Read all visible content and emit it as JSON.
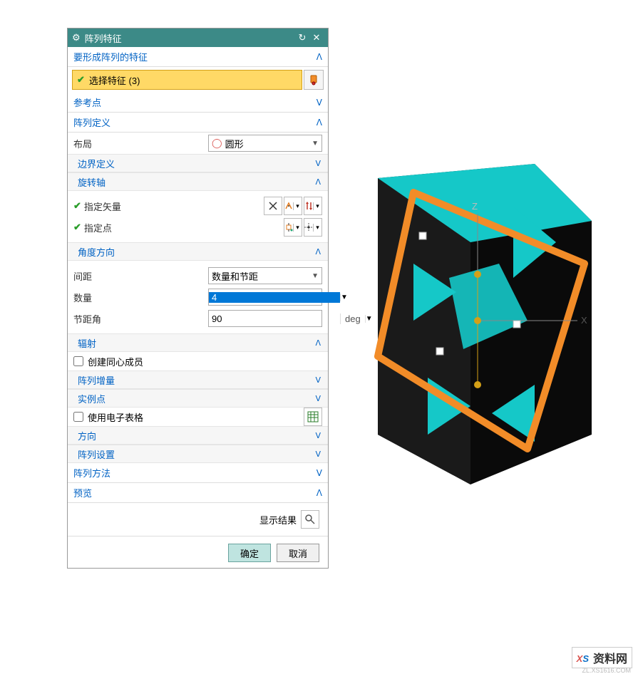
{
  "title": "阵列特征",
  "sections": {
    "features": {
      "title": "要形成阵列的特征",
      "selected_label": "选择特征 (3)"
    },
    "refpoint": {
      "title": "参考点"
    },
    "definition": {
      "title": "阵列定义",
      "layout_label": "布局",
      "layout_value": "圆形",
      "boundary": "边界定义",
      "axis": {
        "title": "旋转轴",
        "vector_label": "指定矢量",
        "point_label": "指定点"
      },
      "angle": {
        "title": "角度方向",
        "spacing_label": "间距",
        "spacing_value": "数量和节距",
        "count_label": "数量",
        "count_value": "4",
        "pitch_label": "节距角",
        "pitch_value": "90",
        "pitch_unit": "deg"
      },
      "radiate": {
        "title": "辐射",
        "concentric_label": "创建同心成员"
      },
      "increment": "阵列增量",
      "instance_points": "实例点",
      "spreadsheet_label": "使用电子表格",
      "orientation": "方向",
      "settings": "阵列设置"
    },
    "method": {
      "title": "阵列方法"
    },
    "preview": {
      "title": "预览",
      "show_result": "显示结果"
    }
  },
  "buttons": {
    "ok": "确定",
    "cancel": "取消"
  },
  "watermark": {
    "brand1": "X",
    "brand2": "S",
    "label": "资料网",
    "url": "ZL.XS1616.COM"
  }
}
